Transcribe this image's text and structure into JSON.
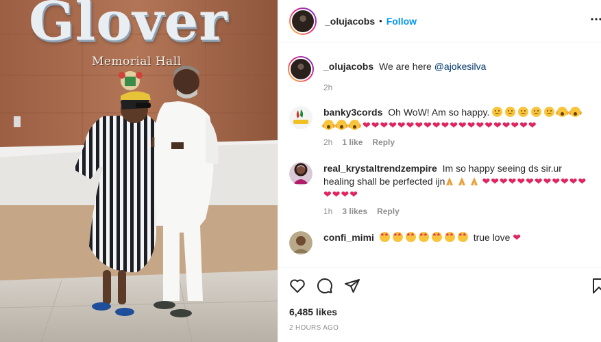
{
  "photo": {
    "sign_main": "Glover",
    "sign_sub": "Memorial Hall"
  },
  "header": {
    "username": "_olujacobs",
    "separator": "•",
    "follow": "Follow",
    "more": "..."
  },
  "caption": {
    "username": "_olujacobs",
    "text": "We are here",
    "mention": "@ajokesilva",
    "time": "2h"
  },
  "comments": [
    {
      "username": "banky3cords",
      "text": "Oh WoW! Am so happy.",
      "time": "2h",
      "likes": "1 like",
      "reply": "Reply"
    },
    {
      "username": "real_krystaltrendzempire",
      "text": "Im so happy seeing ds sir.ur healing shall be perfected ijn",
      "time": "1h",
      "likes": "3 likes",
      "reply": "Reply"
    },
    {
      "username": "confi_mimi",
      "text": "true love",
      "time": "",
      "likes": "",
      "reply": ""
    }
  ],
  "footer": {
    "likes": "6,485 likes",
    "timestamp": "2 HOURS AGO"
  },
  "icons": [
    "more-options-icon",
    "heart-icon",
    "comment-icon",
    "share-icon",
    "bookmark-icon",
    "emoji-icon",
    "praying-hands-icon"
  ],
  "colors": {
    "follow": "#0095f6",
    "mention": "#00376b",
    "heart": "#e0245e",
    "muted": "#8e8e8e"
  }
}
